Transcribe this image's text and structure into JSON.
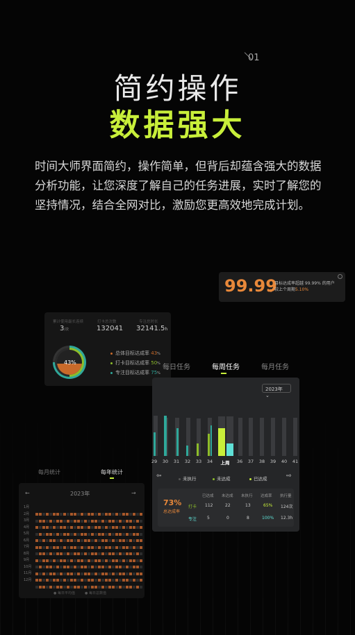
{
  "hero": {
    "number": "01",
    "title_line1": "简约操作",
    "title_line2": "数据强大",
    "description": "时间大师界面简约，操作简单，但背后却蕴含强大的数据分析功能，让您深度了解自己的任务进展，实时了解您的坚持情况，结合全网对比，激励您更高效地完成计划。"
  },
  "colors": {
    "accent": "#c8ef3a",
    "orange": "#e8883a",
    "teal": "#2fa89a",
    "green": "#8dbd2a",
    "bar_bg": "#3a3b3e"
  },
  "badge": {
    "value": "99.99",
    "unit": "%",
    "text_line1": "目标达成率超越 99.99% 的用户",
    "text_line2": "较上个周期",
    "text_highlight": "5.10%"
  },
  "stats": {
    "labels": [
      "累计使用最长连续",
      "打卡总次数",
      "专注总时长"
    ],
    "values": [
      "3",
      "132041",
      "32141.5"
    ],
    "value_units": [
      "/次",
      "",
      "h"
    ],
    "ring_label": "43%",
    "legend": [
      {
        "label": "总体目标达成率",
        "value": "43",
        "color": "#c96a2a"
      },
      {
        "label": "打卡目标达成率",
        "value": "50",
        "color": "#8dbd2a"
      },
      {
        "label": "专注目标达成率",
        "value": "75",
        "color": "#2fa89a"
      }
    ]
  },
  "tabs": {
    "items": [
      "每日任务",
      "每周任务",
      "每月任务"
    ],
    "active": 1
  },
  "weekly": {
    "year_select": "2023年",
    "x_labels": [
      "29",
      "30",
      "31",
      "32",
      "33",
      "34",
      "上周",
      "36",
      "37",
      "38",
      "39",
      "40",
      "41"
    ],
    "legend": [
      "未执行",
      "未达成",
      "已达成"
    ],
    "table": {
      "rate": "73%",
      "rate_label": "总达成率",
      "headers": [
        "已达成",
        "未达成",
        "未执行",
        "达成率",
        "执行量"
      ],
      "rows": [
        {
          "name": "打卡",
          "cells": [
            "112",
            "22",
            "13",
            "65%",
            "124次"
          ]
        },
        {
          "name": "专注",
          "cells": [
            "5",
            "0",
            "8",
            "100%",
            "12.3h"
          ]
        }
      ]
    }
  },
  "yearly": {
    "tabs": [
      "每月统计",
      "每年统计"
    ],
    "year": "2023年",
    "months": [
      "1月",
      "2月",
      "3月",
      "4月",
      "5月",
      "6月",
      "7月",
      "8月",
      "9月",
      "10月",
      "11月",
      "12月"
    ],
    "legend": [
      "每日平均值",
      "每日总数值"
    ]
  }
}
